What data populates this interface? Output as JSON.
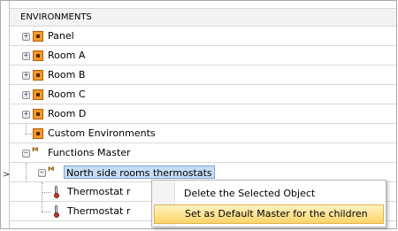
{
  "tree": {
    "header": "ENVIRONMENTS",
    "items": [
      {
        "label": "Panel",
        "icon": "room-icon"
      },
      {
        "label": "Room A",
        "icon": "room-icon"
      },
      {
        "label": "Room B",
        "icon": "room-icon"
      },
      {
        "label": "Room C",
        "icon": "room-icon"
      },
      {
        "label": "Room D",
        "icon": "room-icon"
      },
      {
        "label": "Custom Environments",
        "icon": "custom-env-icon"
      },
      {
        "label": "Functions Master",
        "icon": "functions-master-icon"
      },
      {
        "label": "North side rooms thermostats",
        "icon": "functions-master-icon"
      },
      {
        "label": "Thermostat r",
        "icon": "thermostat-icon"
      },
      {
        "label": "Thermostat r",
        "icon": "thermostat-icon"
      }
    ],
    "expander_collapsed": "+",
    "expander_expanded": "−",
    "row_pointer": ">"
  },
  "context_menu": {
    "items": [
      {
        "label": "Delete the Selected Object"
      },
      {
        "label": "Set as Default Master for the children"
      }
    ]
  },
  "colors": {
    "selection": "#c6ddf6",
    "menu_highlight": "#fbd46a",
    "room_icon": "#f39a2b"
  }
}
